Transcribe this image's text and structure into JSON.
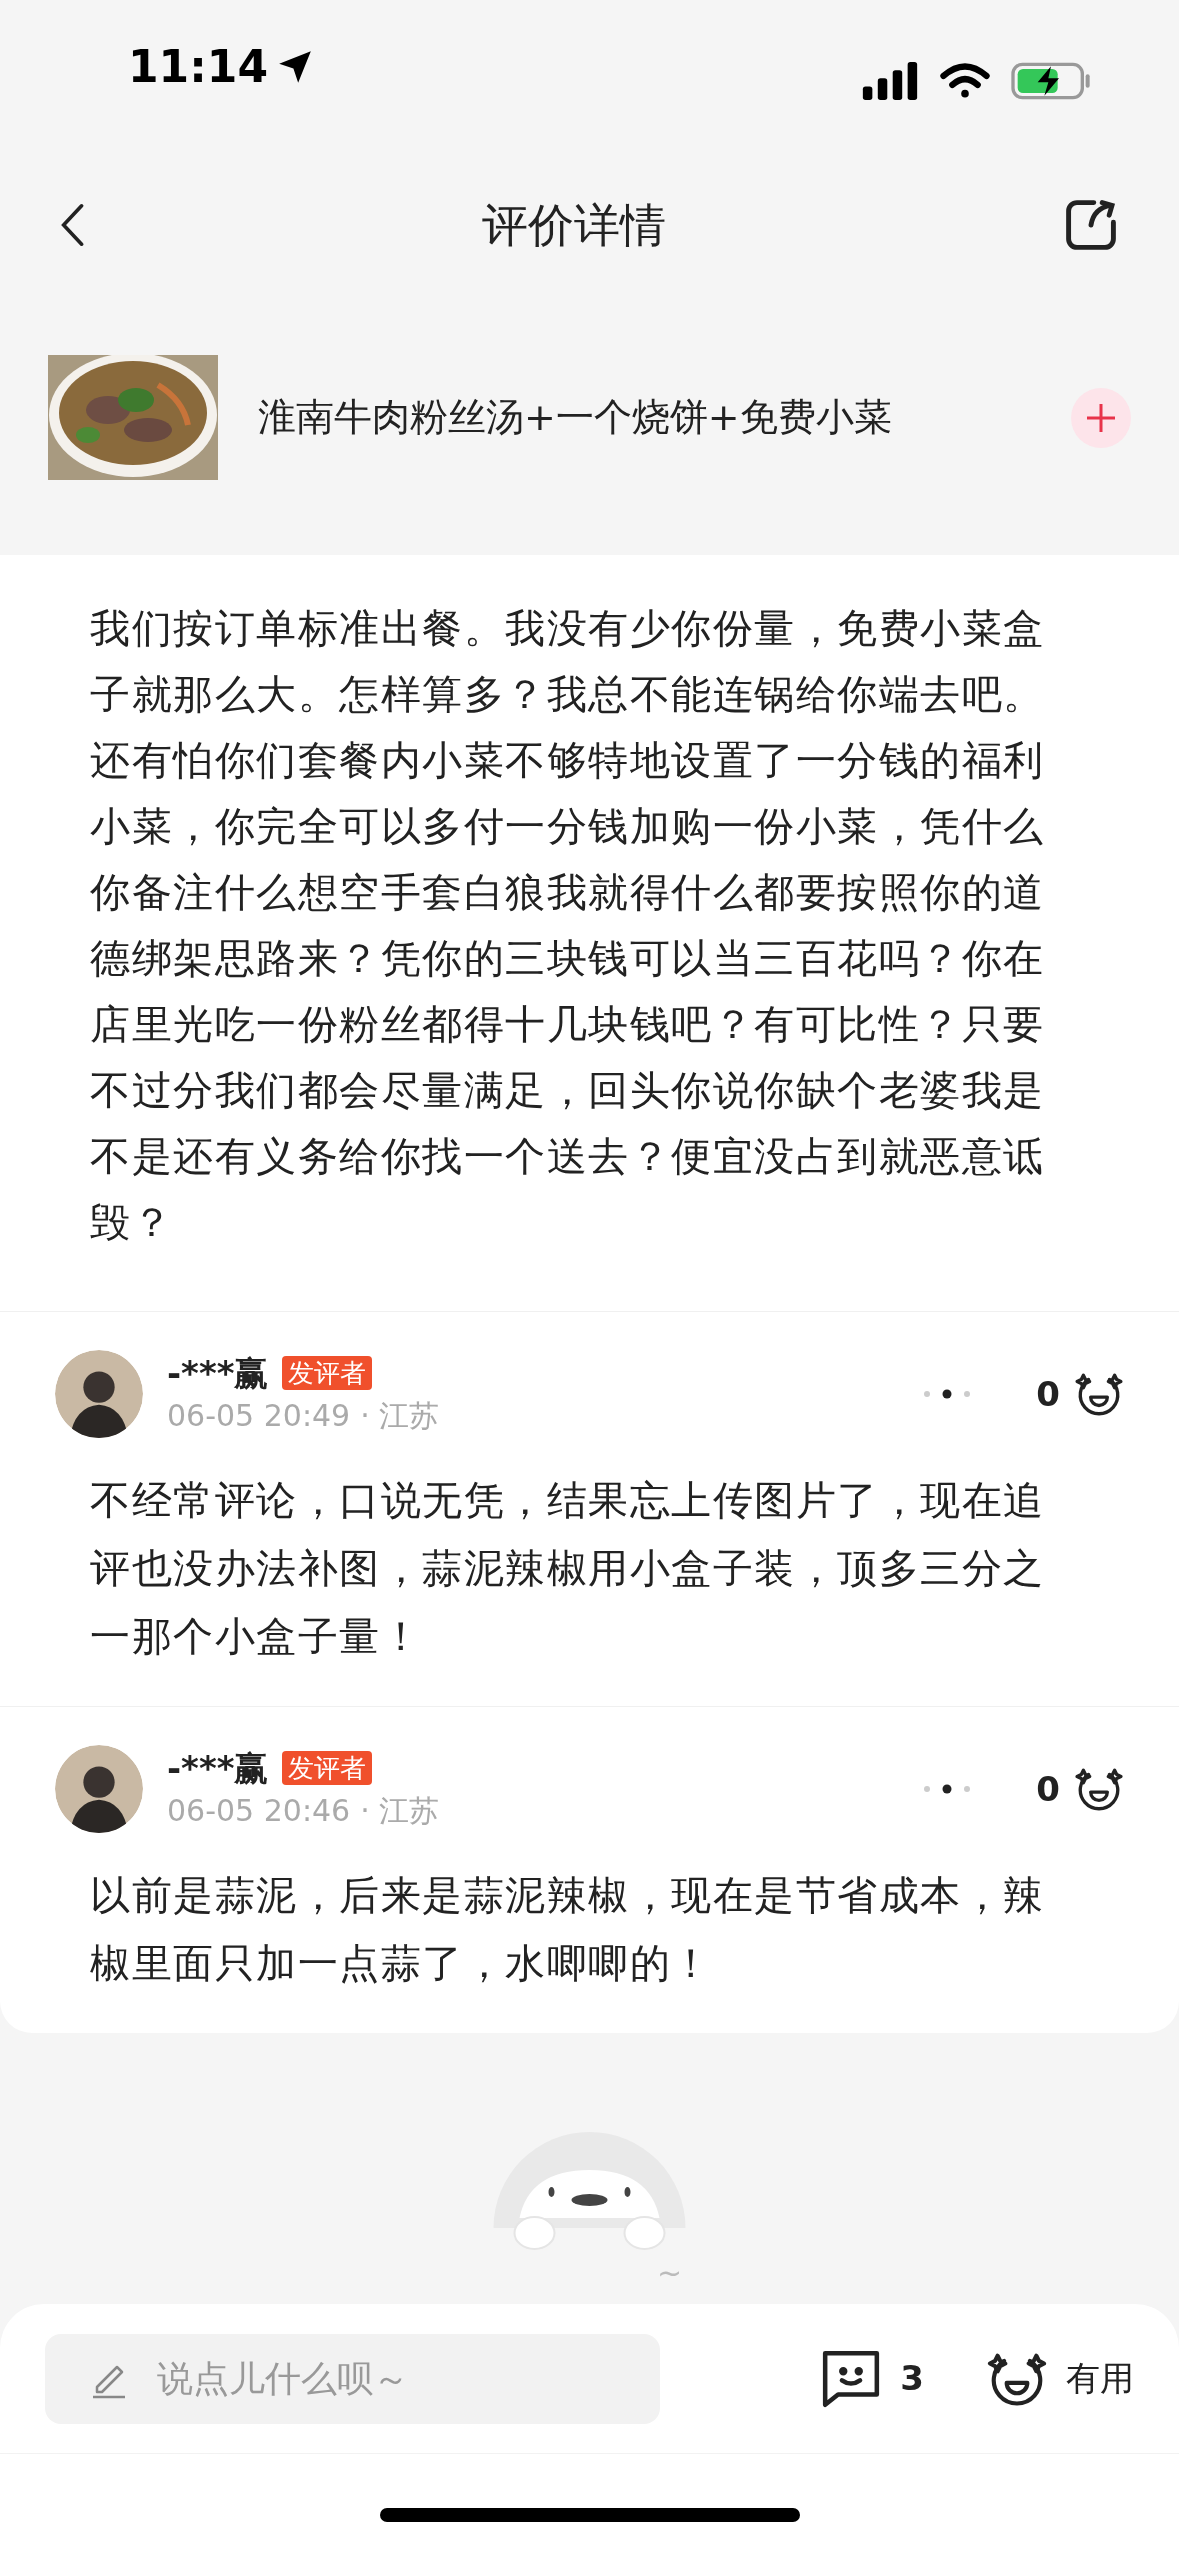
{
  "status_bar": {
    "time": "11:14"
  },
  "header": {
    "title": "评价详情"
  },
  "product": {
    "name": "淮南牛肉粉丝汤+一个烧饼+免费小菜"
  },
  "reply": {
    "text": "我们按订单标准出餐。我没有少你份量，免费小菜盒子就那么大。怎样算多？我总不能连锅给你端去吧。还有怕你们套餐内小菜不够特地设置了一分钱的福利小菜，你完全可以多付一分钱加购一份小菜，凭什么你备注什么想空手套白狼我就得什么都要按照你的道德绑架思路来？凭你的三块钱可以当三百花吗？你在店里光吃一份粉丝都得十几块钱吧？有可比性？只要不过分我们都会尽量满足，回头你说你缺个老婆我是不是还有义务给你找一个送去？便宜没占到就恶意诋毁？"
  },
  "comments": [
    {
      "user": "-***赢",
      "badge": "发评者",
      "time": "06-05 20:49",
      "location": "· 江苏",
      "likes": "0",
      "text": "不经常评论，口说无凭，结果忘上传图片了，现在追评也没办法补图，蒜泥辣椒用小盒子装，顶多三分之一那个小盒子量！"
    },
    {
      "user": "-***赢",
      "badge": "发评者",
      "time": "06-05 20:46",
      "location": "· 江苏",
      "likes": "0",
      "text": "以前是蒜泥，后来是蒜泥辣椒，现在是节省成本，辣椒里面只加一点蒜了，水唧唧的！"
    }
  ],
  "footer_note": "~",
  "bottom_bar": {
    "input": {
      "placeholder": "说点儿什么呗～"
    },
    "comment_count": "3",
    "useful_label": "有用"
  }
}
